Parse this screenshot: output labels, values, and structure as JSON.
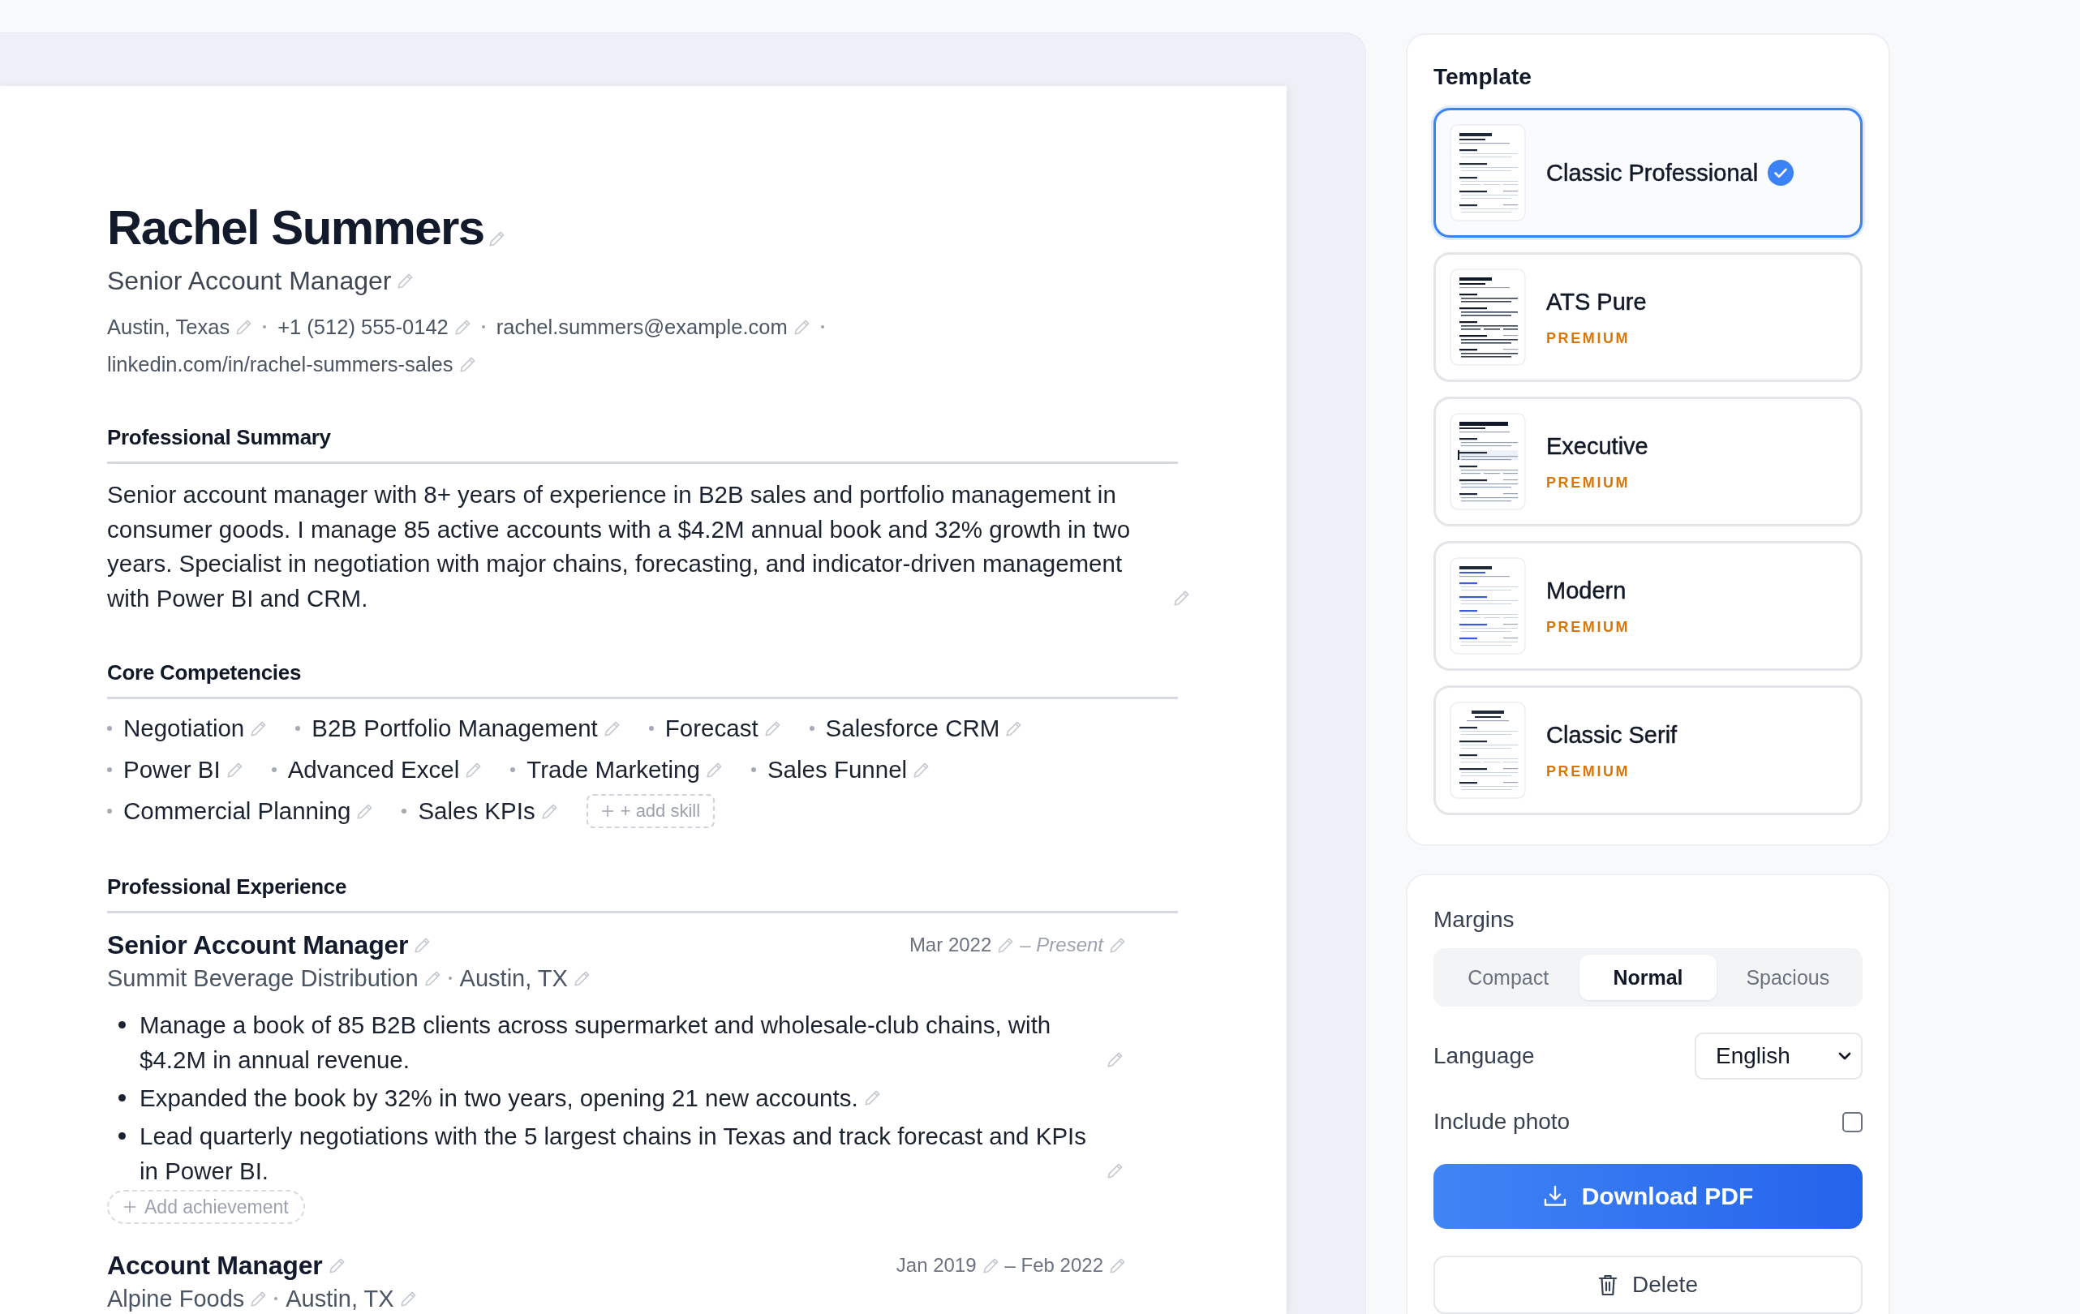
{
  "resume": {
    "name": "Rachel Summers",
    "headline": "Senior Account Manager",
    "contacts": [
      "Austin, Texas",
      "+1 (512) 555-0142",
      "rachel.summers@example.com",
      "linkedin.com/in/rachel-summers-sales"
    ],
    "sections": [
      {
        "kind": "summary",
        "title": "Professional Summary",
        "text": "Senior account manager with 8+ years of experience in B2B sales and portfolio management in consumer goods. I manage 85 active accounts with a $4.2M annual book and 32% growth in two years. Specialist in negotiation with major chains, forecasting, and indicator-driven management with Power BI and CRM."
      },
      {
        "kind": "skills",
        "title": "Core Competencies",
        "skills": [
          "Negotiation",
          "B2B Portfolio Management",
          "Forecast",
          "Salesforce CRM",
          "Power BI",
          "Advanced Excel",
          "Trade Marketing",
          "Sales Funnel",
          "Commercial Planning",
          "Sales KPIs"
        ],
        "add_label": "+ add skill"
      },
      {
        "kind": "experience",
        "title": "Professional Experience",
        "jobs": [
          {
            "role": "Senior Account Manager",
            "company": "Summit Beverage Distribution",
            "location": "Austin, TX",
            "start": "Mar 2022",
            "end": "– Present",
            "current": true,
            "achievements": [
              "Manage a book of 85 B2B clients across supermarket and wholesale-club chains, with $4.2M in annual revenue.",
              "Expanded the book by 32% in two years, opening 21 new accounts.",
              "Lead quarterly negotiations with the 5 largest chains in Texas and track forecast and KPIs in Power BI."
            ],
            "add_label": "Add achievement"
          },
          {
            "role": "Account Manager",
            "company": "Alpine Foods",
            "location": "Austin, TX",
            "start": "Jan 2019",
            "end": "– Feb 2022",
            "current": false
          }
        ]
      }
    ]
  },
  "template_panel": {
    "title": "Template",
    "templates": [
      {
        "name": "Classic Professional",
        "kind": "classic",
        "selected": true
      },
      {
        "name": "ATS Pure",
        "kind": "ats",
        "selected": false,
        "badge": "PREMIUM"
      },
      {
        "name": "Executive",
        "kind": "executive",
        "selected": false,
        "badge": "PREMIUM"
      },
      {
        "name": "Modern",
        "kind": "modern",
        "selected": false,
        "badge": "PREMIUM"
      },
      {
        "name": "Classic Serif",
        "kind": "serif",
        "selected": false,
        "badge": "PREMIUM"
      }
    ]
  },
  "settings": {
    "margins": {
      "label": "Margins",
      "options": [
        {
          "label": "Compact",
          "selected": false
        },
        {
          "label": "Normal",
          "selected": true
        },
        {
          "label": "Spacious",
          "selected": false
        }
      ]
    },
    "language": {
      "label": "Language",
      "value": "English"
    },
    "include_photo": {
      "label": "Include photo",
      "checked": false
    },
    "buttons": [
      {
        "kind": "download",
        "label": "Download PDF"
      },
      {
        "kind": "delete",
        "label": "Delete"
      }
    ]
  }
}
